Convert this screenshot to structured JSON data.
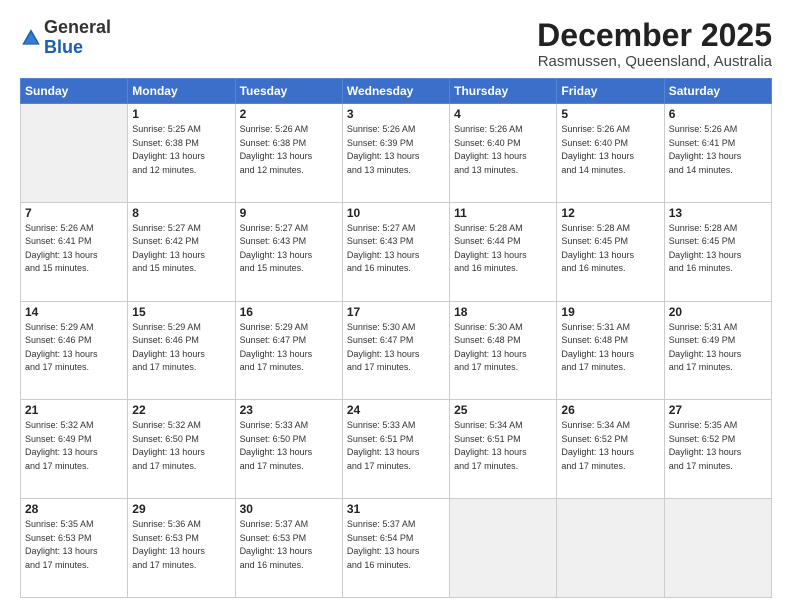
{
  "logo": {
    "general": "General",
    "blue": "Blue"
  },
  "header": {
    "month": "December 2025",
    "location": "Rasmussen, Queensland, Australia"
  },
  "weekdays": [
    "Sunday",
    "Monday",
    "Tuesday",
    "Wednesday",
    "Thursday",
    "Friday",
    "Saturday"
  ],
  "weeks": [
    [
      {
        "day": "",
        "sunrise": "",
        "sunset": "",
        "daylight": "",
        "empty": true
      },
      {
        "day": "1",
        "sunrise": "Sunrise: 5:25 AM",
        "sunset": "Sunset: 6:38 PM",
        "daylight": "Daylight: 13 hours and 12 minutes."
      },
      {
        "day": "2",
        "sunrise": "Sunrise: 5:26 AM",
        "sunset": "Sunset: 6:38 PM",
        "daylight": "Daylight: 13 hours and 12 minutes."
      },
      {
        "day": "3",
        "sunrise": "Sunrise: 5:26 AM",
        "sunset": "Sunset: 6:39 PM",
        "daylight": "Daylight: 13 hours and 13 minutes."
      },
      {
        "day": "4",
        "sunrise": "Sunrise: 5:26 AM",
        "sunset": "Sunset: 6:40 PM",
        "daylight": "Daylight: 13 hours and 13 minutes."
      },
      {
        "day": "5",
        "sunrise": "Sunrise: 5:26 AM",
        "sunset": "Sunset: 6:40 PM",
        "daylight": "Daylight: 13 hours and 14 minutes."
      },
      {
        "day": "6",
        "sunrise": "Sunrise: 5:26 AM",
        "sunset": "Sunset: 6:41 PM",
        "daylight": "Daylight: 13 hours and 14 minutes."
      }
    ],
    [
      {
        "day": "7",
        "sunrise": "Sunrise: 5:26 AM",
        "sunset": "Sunset: 6:41 PM",
        "daylight": "Daylight: 13 hours and 15 minutes."
      },
      {
        "day": "8",
        "sunrise": "Sunrise: 5:27 AM",
        "sunset": "Sunset: 6:42 PM",
        "daylight": "Daylight: 13 hours and 15 minutes."
      },
      {
        "day": "9",
        "sunrise": "Sunrise: 5:27 AM",
        "sunset": "Sunset: 6:43 PM",
        "daylight": "Daylight: 13 hours and 15 minutes."
      },
      {
        "day": "10",
        "sunrise": "Sunrise: 5:27 AM",
        "sunset": "Sunset: 6:43 PM",
        "daylight": "Daylight: 13 hours and 16 minutes."
      },
      {
        "day": "11",
        "sunrise": "Sunrise: 5:28 AM",
        "sunset": "Sunset: 6:44 PM",
        "daylight": "Daylight: 13 hours and 16 minutes."
      },
      {
        "day": "12",
        "sunrise": "Sunrise: 5:28 AM",
        "sunset": "Sunset: 6:45 PM",
        "daylight": "Daylight: 13 hours and 16 minutes."
      },
      {
        "day": "13",
        "sunrise": "Sunrise: 5:28 AM",
        "sunset": "Sunset: 6:45 PM",
        "daylight": "Daylight: 13 hours and 16 minutes."
      }
    ],
    [
      {
        "day": "14",
        "sunrise": "Sunrise: 5:29 AM",
        "sunset": "Sunset: 6:46 PM",
        "daylight": "Daylight: 13 hours and 17 minutes."
      },
      {
        "day": "15",
        "sunrise": "Sunrise: 5:29 AM",
        "sunset": "Sunset: 6:46 PM",
        "daylight": "Daylight: 13 hours and 17 minutes."
      },
      {
        "day": "16",
        "sunrise": "Sunrise: 5:29 AM",
        "sunset": "Sunset: 6:47 PM",
        "daylight": "Daylight: 13 hours and 17 minutes."
      },
      {
        "day": "17",
        "sunrise": "Sunrise: 5:30 AM",
        "sunset": "Sunset: 6:47 PM",
        "daylight": "Daylight: 13 hours and 17 minutes."
      },
      {
        "day": "18",
        "sunrise": "Sunrise: 5:30 AM",
        "sunset": "Sunset: 6:48 PM",
        "daylight": "Daylight: 13 hours and 17 minutes."
      },
      {
        "day": "19",
        "sunrise": "Sunrise: 5:31 AM",
        "sunset": "Sunset: 6:48 PM",
        "daylight": "Daylight: 13 hours and 17 minutes."
      },
      {
        "day": "20",
        "sunrise": "Sunrise: 5:31 AM",
        "sunset": "Sunset: 6:49 PM",
        "daylight": "Daylight: 13 hours and 17 minutes."
      }
    ],
    [
      {
        "day": "21",
        "sunrise": "Sunrise: 5:32 AM",
        "sunset": "Sunset: 6:49 PM",
        "daylight": "Daylight: 13 hours and 17 minutes."
      },
      {
        "day": "22",
        "sunrise": "Sunrise: 5:32 AM",
        "sunset": "Sunset: 6:50 PM",
        "daylight": "Daylight: 13 hours and 17 minutes."
      },
      {
        "day": "23",
        "sunrise": "Sunrise: 5:33 AM",
        "sunset": "Sunset: 6:50 PM",
        "daylight": "Daylight: 13 hours and 17 minutes."
      },
      {
        "day": "24",
        "sunrise": "Sunrise: 5:33 AM",
        "sunset": "Sunset: 6:51 PM",
        "daylight": "Daylight: 13 hours and 17 minutes."
      },
      {
        "day": "25",
        "sunrise": "Sunrise: 5:34 AM",
        "sunset": "Sunset: 6:51 PM",
        "daylight": "Daylight: 13 hours and 17 minutes."
      },
      {
        "day": "26",
        "sunrise": "Sunrise: 5:34 AM",
        "sunset": "Sunset: 6:52 PM",
        "daylight": "Daylight: 13 hours and 17 minutes."
      },
      {
        "day": "27",
        "sunrise": "Sunrise: 5:35 AM",
        "sunset": "Sunset: 6:52 PM",
        "daylight": "Daylight: 13 hours and 17 minutes."
      }
    ],
    [
      {
        "day": "28",
        "sunrise": "Sunrise: 5:35 AM",
        "sunset": "Sunset: 6:53 PM",
        "daylight": "Daylight: 13 hours and 17 minutes."
      },
      {
        "day": "29",
        "sunrise": "Sunrise: 5:36 AM",
        "sunset": "Sunset: 6:53 PM",
        "daylight": "Daylight: 13 hours and 17 minutes."
      },
      {
        "day": "30",
        "sunrise": "Sunrise: 5:37 AM",
        "sunset": "Sunset: 6:53 PM",
        "daylight": "Daylight: 13 hours and 16 minutes."
      },
      {
        "day": "31",
        "sunrise": "Sunrise: 5:37 AM",
        "sunset": "Sunset: 6:54 PM",
        "daylight": "Daylight: 13 hours and 16 minutes."
      },
      {
        "day": "",
        "sunrise": "",
        "sunset": "",
        "daylight": "",
        "empty": true
      },
      {
        "day": "",
        "sunrise": "",
        "sunset": "",
        "daylight": "",
        "empty": true
      },
      {
        "day": "",
        "sunrise": "",
        "sunset": "",
        "daylight": "",
        "empty": true
      }
    ]
  ]
}
